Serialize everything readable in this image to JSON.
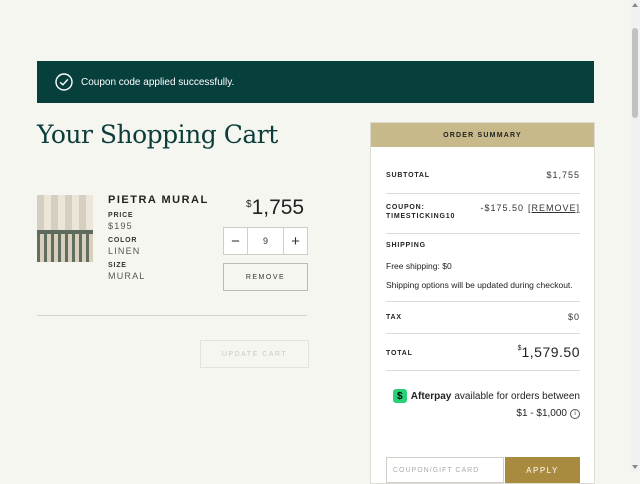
{
  "notice": {
    "message": "Coupon code applied successfully."
  },
  "page": {
    "title": "Your Shopping Cart"
  },
  "item": {
    "name": "PIETRA MURAL",
    "attributes": [
      {
        "label": "PRICE",
        "value": "$195"
      },
      {
        "label": "COLOR",
        "value": "LINEN"
      },
      {
        "label": "SIZE",
        "value": "MURAL"
      }
    ],
    "price_symbol": "$",
    "price_amount": "1,755",
    "quantity": "9",
    "decrease_label": "−",
    "increase_label": "+",
    "remove_label": "REMOVE"
  },
  "cart": {
    "update_label": "UPDATE CART"
  },
  "summary": {
    "header": "ORDER SUMMARY",
    "subtotal_label": "SUBTOTAL",
    "subtotal_value": "$1,755",
    "coupon_label_line1": "COUPON:",
    "coupon_label_line2": "TIMESTICKING10",
    "coupon_value": "-$175.50",
    "coupon_remove": "[REMOVE]",
    "shipping_label": "SHIPPING",
    "shipping_line1": "Free shipping: $0",
    "shipping_line2": "Shipping options will be updated during checkout.",
    "tax_label": "TAX",
    "tax_value": "$0",
    "total_label": "TOTAL",
    "total_symbol": "$",
    "total_amount": "1,579.50",
    "afterpay_logo": "$",
    "afterpay_brand": "Afterpay",
    "afterpay_text": "available for orders between",
    "afterpay_range": "$1 - $1,000",
    "afterpay_info": "i",
    "coupon_placeholder": "COUPON/GIFT CARD",
    "apply_label": "APPLY"
  },
  "colors": {
    "notice_bg": "#073f3d",
    "summary_header": "#c8b98a",
    "apply_button": "#a98b3f",
    "title": "#0d3d3a"
  }
}
